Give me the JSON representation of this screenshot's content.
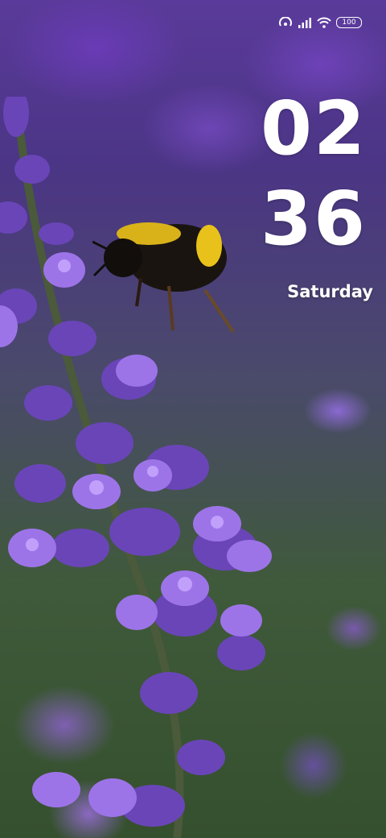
{
  "status_bar": {
    "icons": [
      "hotspot-icon",
      "signal-icon",
      "wifi-icon",
      "battery-icon"
    ],
    "battery_level": "100"
  },
  "clock": {
    "hour": "02",
    "minute": "36",
    "weekday": "Saturday"
  },
  "wallpaper": {
    "subject": "bee-on-lavender",
    "colors": {
      "lavender": "#8a5bd6",
      "foliage": "#3f5a3a",
      "bee_yellow": "#e8c21a"
    }
  }
}
